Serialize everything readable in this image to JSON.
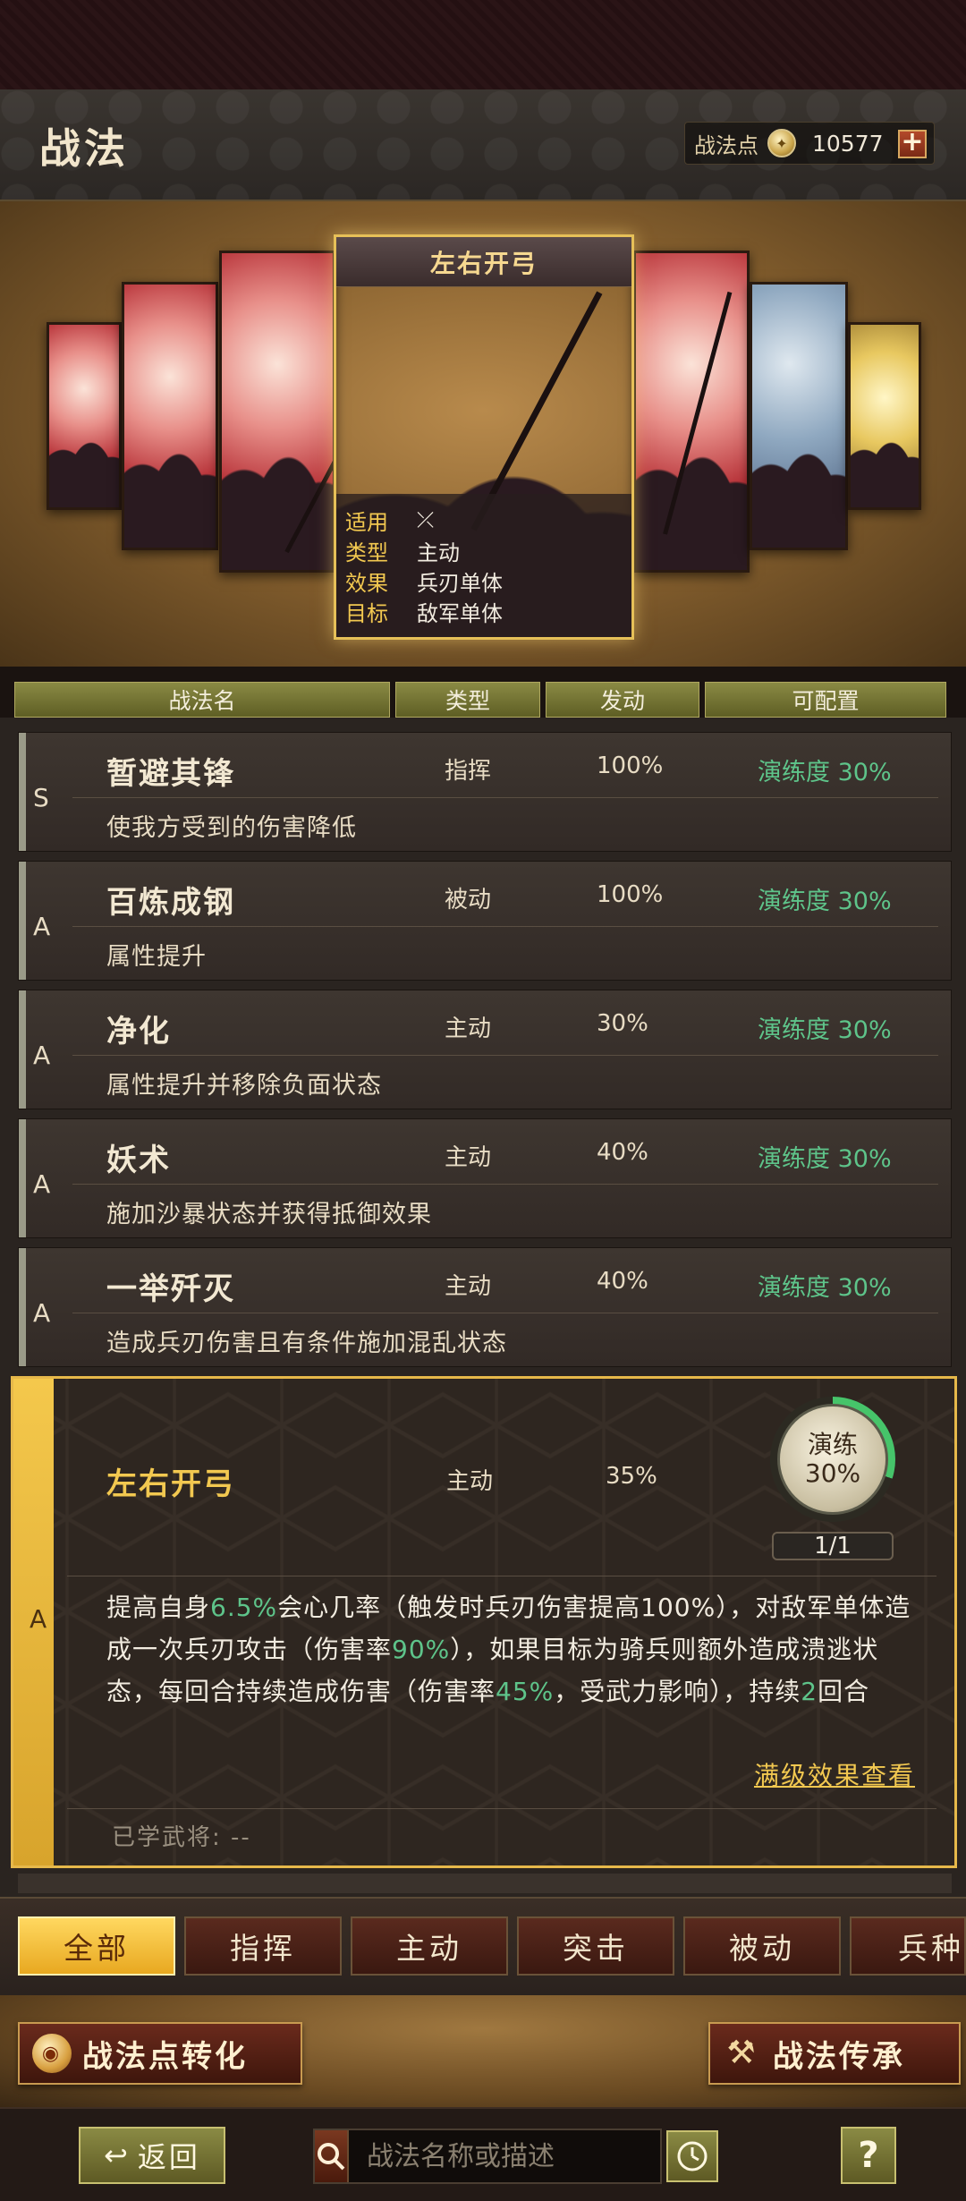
{
  "header": {
    "title": "战法",
    "points_label": "战法点",
    "points_value": "10577",
    "plus_label": "+"
  },
  "featured_card": {
    "title": "左右开弓",
    "rows": [
      {
        "key": "适用",
        "value": ""
      },
      {
        "key": "类型",
        "value": "主动"
      },
      {
        "key": "效果",
        "value": "兵刃单体"
      },
      {
        "key": "目标",
        "value": "敌军单体"
      }
    ],
    "applicable_icon": "crossed-bows-icon"
  },
  "table": {
    "headers": [
      "战法名",
      "类型",
      "发动",
      "可配置"
    ]
  },
  "rows": [
    {
      "grade": "S",
      "name": "暂避其锋",
      "type": "指挥",
      "rate": "100%",
      "practice": "演练度 30%",
      "desc": "使我方受到的伤害降低"
    },
    {
      "grade": "A",
      "name": "百炼成钢",
      "type": "被动",
      "rate": "100%",
      "practice": "演练度 30%",
      "desc": "属性提升"
    },
    {
      "grade": "A",
      "name": "净化",
      "type": "主动",
      "rate": "30%",
      "practice": "演练度 30%",
      "desc": "属性提升并移除负面状态"
    },
    {
      "grade": "A",
      "name": "妖术",
      "type": "主动",
      "rate": "40%",
      "practice": "演练度 30%",
      "desc": "施加沙暴状态并获得抵御效果"
    },
    {
      "grade": "A",
      "name": "一举歼灭",
      "type": "主动",
      "rate": "40%",
      "practice": "演练度 30%",
      "desc": "造成兵刃伤害且有条件施加混乱状态"
    }
  ],
  "selected": {
    "grade": "A",
    "name": "左右开弓",
    "type": "主动",
    "rate": "35%",
    "practice_line1": "演练",
    "practice_line2": "30%",
    "practice_progress": 0.3,
    "count": "1/1",
    "desc_parts": [
      {
        "t": "提高自身",
        "g": false
      },
      {
        "t": "6.5%",
        "g": true
      },
      {
        "t": "会心几率（触发时兵刃伤害提高100%），对敌军单体造成一次兵刃攻击（伤害率",
        "g": false
      },
      {
        "t": "90%",
        "g": true
      },
      {
        "t": "），如果目标为骑兵则额外造成溃逃状态，每回合持续造成伤害（伤害率",
        "g": false
      },
      {
        "t": "45%",
        "g": true
      },
      {
        "t": "，受武力影响），持续",
        "g": false
      },
      {
        "t": "2",
        "g": true
      },
      {
        "t": "回合",
        "g": false
      }
    ],
    "full_effect_link": "满级效果查看",
    "learned_label": "已学武将: --"
  },
  "filter_tabs": [
    {
      "label": "全部",
      "active": true
    },
    {
      "label": "指挥",
      "active": false
    },
    {
      "label": "主动",
      "active": false
    },
    {
      "label": "突击",
      "active": false
    },
    {
      "label": "被动",
      "active": false
    },
    {
      "label": "兵种",
      "active": false
    }
  ],
  "actions": {
    "convert_label": "战法点转化",
    "inherit_label": "战法传承"
  },
  "footer": {
    "back_label": "返回",
    "search_placeholder": "战法名称或描述",
    "help_label": "?"
  },
  "colors": {
    "practice_green": "#5ec48a",
    "gold": "#f2c850",
    "active_tab": "#ffd860"
  }
}
